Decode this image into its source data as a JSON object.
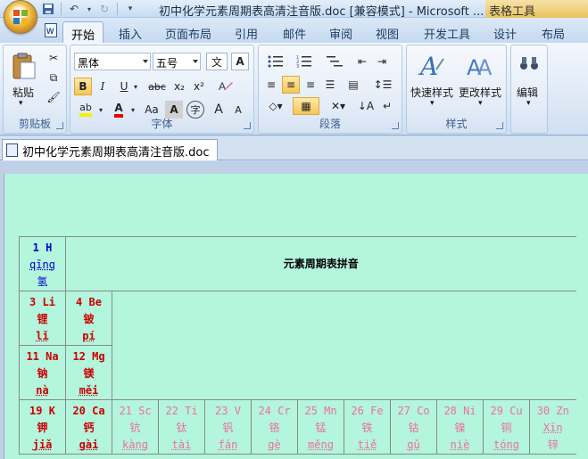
{
  "window": {
    "title": "初中化学元素周期表高清注音版.doc [兼容模式] - Microsoft ...",
    "context_tab_title": "表格工具"
  },
  "tabs": [
    {
      "label": "开始",
      "active": true
    },
    {
      "label": "插入"
    },
    {
      "label": "页面布局"
    },
    {
      "label": "引用"
    },
    {
      "label": "邮件"
    },
    {
      "label": "审阅"
    },
    {
      "label": "视图"
    },
    {
      "label": "开发工具"
    },
    {
      "label": "设计"
    },
    {
      "label": "布局"
    }
  ],
  "ribbon": {
    "clipboard": {
      "label": "剪贴板",
      "paste": "粘贴"
    },
    "font": {
      "label": "字体",
      "font_name": "黑体",
      "font_size": "五号",
      "pinyin_glyph": "文",
      "char_border_glyph": "A",
      "bold": "B",
      "italic": "I",
      "underline": "U",
      "strike": "abc",
      "subscript": "x₂",
      "superscript": "x²",
      "change_case": "Aa",
      "shading": "A",
      "enclose": "字",
      "grow": "A",
      "shrink": "A",
      "highlight_text": "ab",
      "color_text": "A"
    },
    "paragraph": {
      "label": "段落"
    },
    "styles": {
      "label": "样式",
      "quick_styles": "快速样式",
      "change_styles": "更改样式"
    },
    "editing": {
      "label": "编辑"
    }
  },
  "document_tab": "初中化学元素周期表高清注音版.doc",
  "table": {
    "title": "元素周期表拼音",
    "row1": [
      {
        "num": "1 H",
        "py": "qīng",
        "ch": "氢"
      }
    ],
    "row2": [
      {
        "num": "3 Li",
        "ch": "锂",
        "py": "lǐ"
      },
      {
        "num": "4 Be",
        "ch": "铍",
        "py": "pí"
      }
    ],
    "row3": [
      {
        "num": "11 Na",
        "ch": "钠",
        "py": "nà"
      },
      {
        "num": "12 Mg",
        "ch": "镁",
        "py": "měi"
      }
    ],
    "row4": [
      {
        "num": "19 K",
        "ch": "钾",
        "py": "jiǎ",
        "color": "red"
      },
      {
        "num": "20 Ca",
        "ch": "钙",
        "py": "gài",
        "color": "red"
      },
      {
        "num": "21 Sc",
        "ch": "钪",
        "py": "kàng",
        "color": "pink"
      },
      {
        "num": "22 Ti",
        "ch": "钛",
        "py": "tài",
        "color": "pink"
      },
      {
        "num": "23 V",
        "ch": "钒",
        "py": "fán",
        "color": "pink"
      },
      {
        "num": "24 Cr",
        "ch": "铬",
        "py": "gè",
        "color": "pink"
      },
      {
        "num": "25 Mn",
        "ch": "锰",
        "py": "měng",
        "color": "pink"
      },
      {
        "num": "26 Fe",
        "ch": "铁",
        "py": "tiě",
        "color": "pink"
      },
      {
        "num": "27 Co",
        "ch": "钴",
        "py": "gǔ",
        "color": "pink"
      },
      {
        "num": "28 Ni",
        "ch": "镍",
        "py": "niè",
        "color": "pink"
      },
      {
        "num": "29 Cu",
        "ch": "铜",
        "py": "tóng",
        "color": "pink"
      },
      {
        "num": "30 Zn",
        "ch": "锌",
        "py": "Xīn",
        "color": "pink"
      }
    ]
  }
}
